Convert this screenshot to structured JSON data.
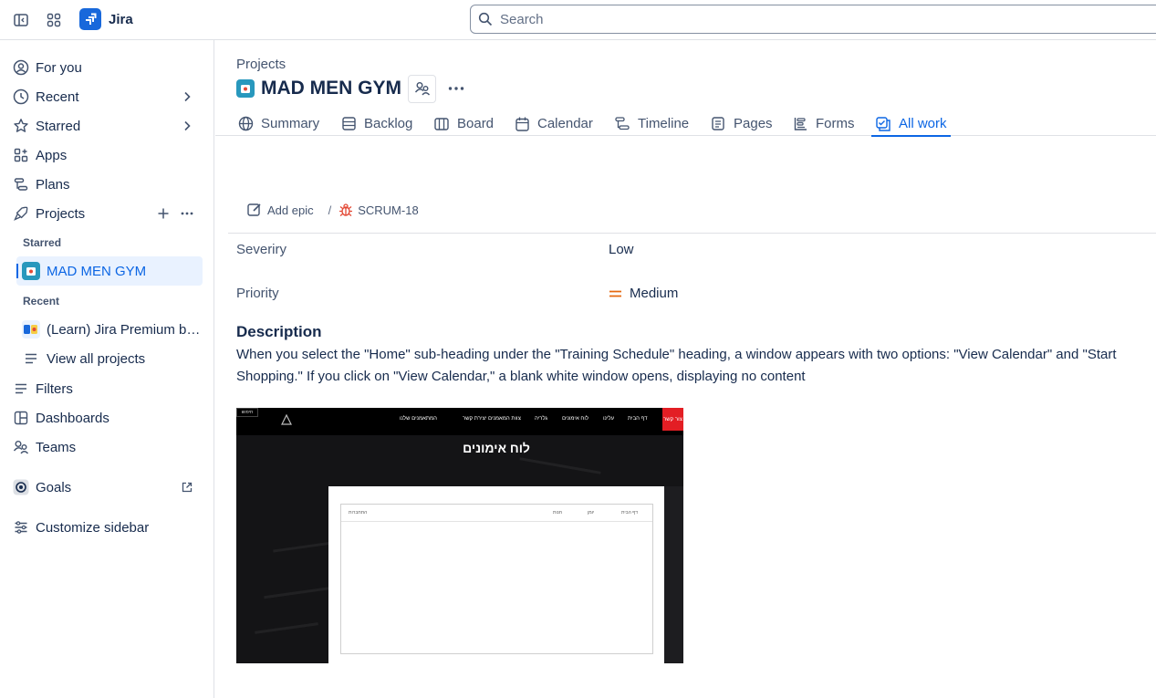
{
  "topbar": {
    "app_name": "Jira",
    "search_placeholder": "Search"
  },
  "sidebar": {
    "for_you": "For you",
    "recent": "Recent",
    "starred": "Starred",
    "apps": "Apps",
    "plans": "Plans",
    "projects": "Projects",
    "starred_section": "Starred",
    "starred_project": "MAD MEN GYM",
    "recent_section": "Recent",
    "recent_project": "(Learn) Jira Premium benefits",
    "view_all": "View all projects",
    "filters": "Filters",
    "dashboards": "Dashboards",
    "teams": "Teams",
    "goals": "Goals",
    "customize": "Customize sidebar"
  },
  "header": {
    "breadcrumb": "Projects",
    "project_title": "MAD MEN GYM"
  },
  "tabs": {
    "summary": "Summary",
    "backlog": "Backlog",
    "board": "Board",
    "calendar": "Calendar",
    "timeline": "Timeline",
    "pages": "Pages",
    "forms": "Forms",
    "all_work": "All work",
    "active": "All work"
  },
  "issue": {
    "add_epic": "Add epic",
    "separator": "/",
    "key": "SCRUM-18",
    "fields": {
      "severity_label": "Severiry",
      "severity_value": "Low",
      "priority_label": "Priority",
      "priority_value": "Medium"
    },
    "description_heading": "Description",
    "description_text": "When you select the \"Home\" sub-heading under the \"Training Schedule\" heading, a window appears with two options: \"View Calendar\" and \"Start Shopping.\" If you click on \"View Calendar,\" a blank white window opens, displaying no content",
    "attachment": {
      "nav_button": "צור קשר",
      "nav_links": [
        "דף הבית",
        "עלינו",
        "לוח אימונים",
        "גלריה",
        "צוות המאמנים",
        "יצירת קשר",
        "המתאמנים שלנו"
      ],
      "search_label": "חיפוש",
      "page_title": "לוח אימונים",
      "inner_tabs": [
        "דף הבית",
        "יומן",
        "חנות",
        "התחברות"
      ]
    }
  },
  "colors": {
    "accent": "#0c66e4",
    "brand": "#1868db",
    "bug": "#e34935",
    "priority_medium": "#e56910"
  }
}
